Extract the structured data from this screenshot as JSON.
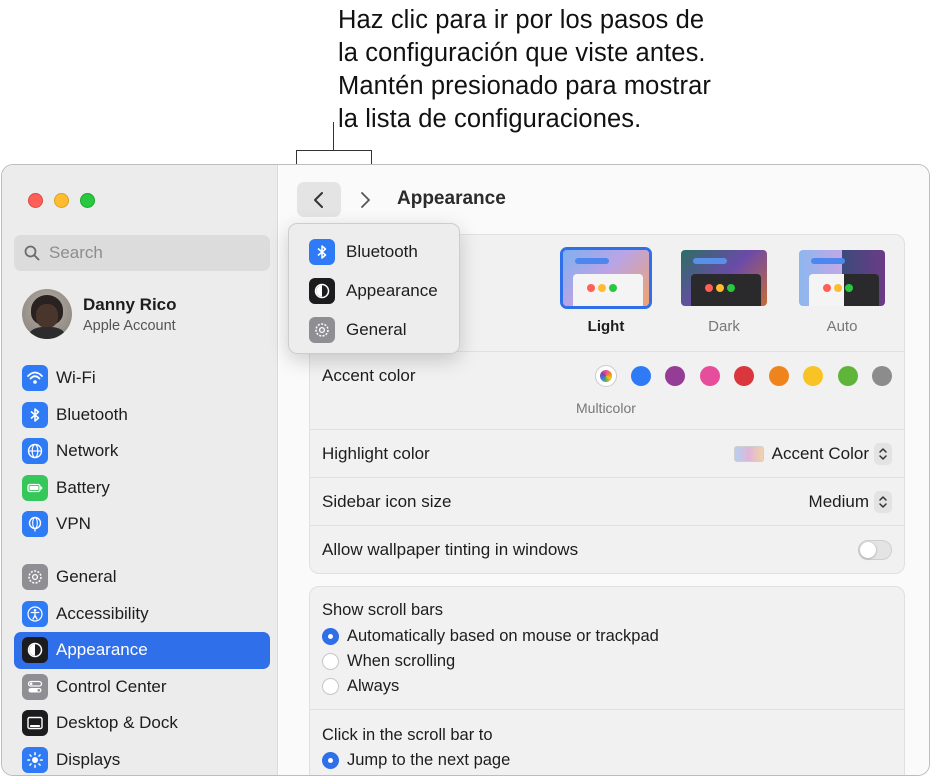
{
  "callout": {
    "lines": [
      "Haz clic para ir por los pasos de",
      "la configuración que viste antes.",
      "Mantén presionado para mostrar",
      "la lista de configuraciones."
    ]
  },
  "sidebar": {
    "search_placeholder": "Search",
    "profile": {
      "name": "Danny Rico",
      "subtitle": "Apple Account"
    },
    "items": [
      {
        "label": "Wi-Fi",
        "icon": "wifi-icon",
        "color": "#2f7bf6"
      },
      {
        "label": "Bluetooth",
        "icon": "bluetooth-icon",
        "color": "#2f7bf6"
      },
      {
        "label": "Network",
        "icon": "globe-icon",
        "color": "#2f7bf6"
      },
      {
        "label": "Battery",
        "icon": "battery-icon",
        "color": "#35c759"
      },
      {
        "label": "VPN",
        "icon": "vpn-icon",
        "color": "#2f7bf6"
      },
      {
        "label": "General",
        "icon": "gear-icon",
        "color": "#8e8e93"
      },
      {
        "label": "Accessibility",
        "icon": "accessibility-icon",
        "color": "#2f7bf6"
      },
      {
        "label": "Appearance",
        "icon": "appearance-icon",
        "color": "#1c1c1e",
        "active": true
      },
      {
        "label": "Control Center",
        "icon": "control-center-icon",
        "color": "#8e8e93"
      },
      {
        "label": "Desktop & Dock",
        "icon": "desktop-dock-icon",
        "color": "#1c1c1e"
      },
      {
        "label": "Displays",
        "icon": "displays-icon",
        "color": "#2f7bf6"
      }
    ]
  },
  "toolbar": {
    "title": "Appearance"
  },
  "history_menu": {
    "items": [
      {
        "label": "Bluetooth",
        "icon": "bluetooth-icon"
      },
      {
        "label": "Appearance",
        "icon": "appearance-icon"
      },
      {
        "label": "General",
        "icon": "gear-icon"
      }
    ]
  },
  "appearance": {
    "themes": [
      {
        "label": "Light",
        "selected": true
      },
      {
        "label": "Dark",
        "selected": false
      },
      {
        "label": "Auto",
        "selected": false
      }
    ],
    "accent_color": {
      "label": "Accent color",
      "selected_caption": "Multicolor",
      "swatches": [
        "multicolor",
        "#2f7bf6",
        "#953d96",
        "#e64e9c",
        "#d9363e",
        "#f0841c",
        "#f7c325",
        "#5fb43a",
        "#8c8c8c"
      ]
    },
    "highlight_color": {
      "label": "Highlight color",
      "value": "Accent Color"
    },
    "sidebar_icon_size": {
      "label": "Sidebar icon size",
      "value": "Medium"
    },
    "wallpaper_tinting": {
      "label": "Allow wallpaper tinting in windows",
      "enabled": false
    }
  },
  "scroll_bars": {
    "heading": "Show scroll bars",
    "options": [
      {
        "label": "Automatically based on mouse or trackpad",
        "checked": true
      },
      {
        "label": "When scrolling",
        "checked": false
      },
      {
        "label": "Always",
        "checked": false
      }
    ],
    "click_heading": "Click in the scroll bar to",
    "click_options": [
      {
        "label": "Jump to the next page",
        "checked": true
      }
    ]
  }
}
